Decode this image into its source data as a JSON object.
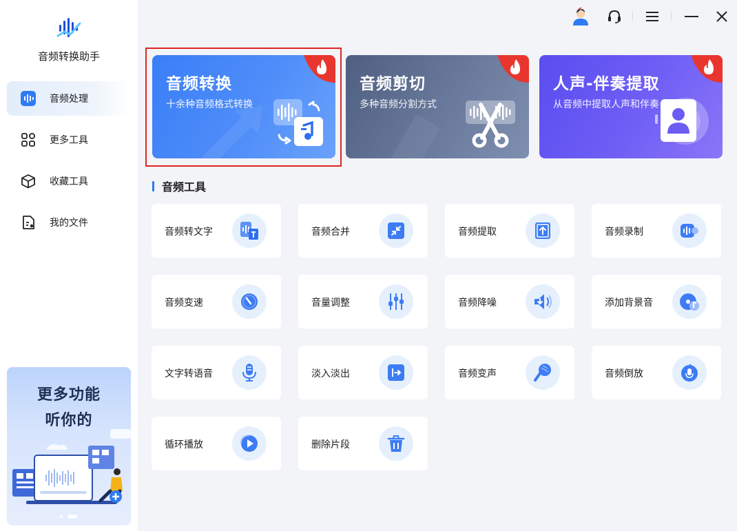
{
  "app": {
    "name": "音频转换助手"
  },
  "sidebar": {
    "items": [
      {
        "label": "音频处理",
        "active": true,
        "icon": "waveform-icon"
      },
      {
        "label": "更多工具",
        "active": false,
        "icon": "grid-icon"
      },
      {
        "label": "收藏工具",
        "active": false,
        "icon": "cube-icon"
      },
      {
        "label": "我的文件",
        "active": false,
        "icon": "file-icon"
      }
    ],
    "promo": {
      "line1": "更多功能",
      "line2": "听你的"
    }
  },
  "window": {
    "controls": [
      "user-avatar-icon",
      "headset-icon",
      "menu-icon",
      "minimize-icon",
      "close-icon"
    ]
  },
  "features": [
    {
      "title": "音频转换",
      "subtitle": "十余种音频格式转换",
      "badge": "hot-flame-icon",
      "color": "#3a7ef7"
    },
    {
      "title": "音频剪切",
      "subtitle": "多种音频分割方式",
      "badge": "hot-flame-icon",
      "color": "#5b6b8e"
    },
    {
      "title": "人声-伴奏提取",
      "subtitle": "从音频中提取人声和伴奏",
      "badge": "hot-flame-icon",
      "color": "#6353f2"
    }
  ],
  "section": {
    "title": "音频工具"
  },
  "tools": [
    {
      "label": "音频转文字",
      "icon": "audio-to-text-icon"
    },
    {
      "label": "音频合并",
      "icon": "merge-icon"
    },
    {
      "label": "音频提取",
      "icon": "extract-icon"
    },
    {
      "label": "音频录制",
      "icon": "record-icon"
    },
    {
      "label": "音频变速",
      "icon": "speed-dial-icon"
    },
    {
      "label": "音量调整",
      "icon": "equalizer-icon"
    },
    {
      "label": "音频降噪",
      "icon": "speaker-down-icon"
    },
    {
      "label": "添加背景音",
      "icon": "disc-music-icon"
    },
    {
      "label": "文字转语音",
      "icon": "microphone-icon"
    },
    {
      "label": "淡入淡出",
      "icon": "fade-icon"
    },
    {
      "label": "音频变声",
      "icon": "voice-change-icon"
    },
    {
      "label": "音频倒放",
      "icon": "reverse-mic-icon"
    },
    {
      "label": "循环播放",
      "icon": "loop-play-icon"
    },
    {
      "label": "删除片段",
      "icon": "trash-icon"
    }
  ],
  "colors": {
    "accent": "#2f7bf3",
    "highlight_border": "#e02323",
    "hot": "#e8362f"
  }
}
